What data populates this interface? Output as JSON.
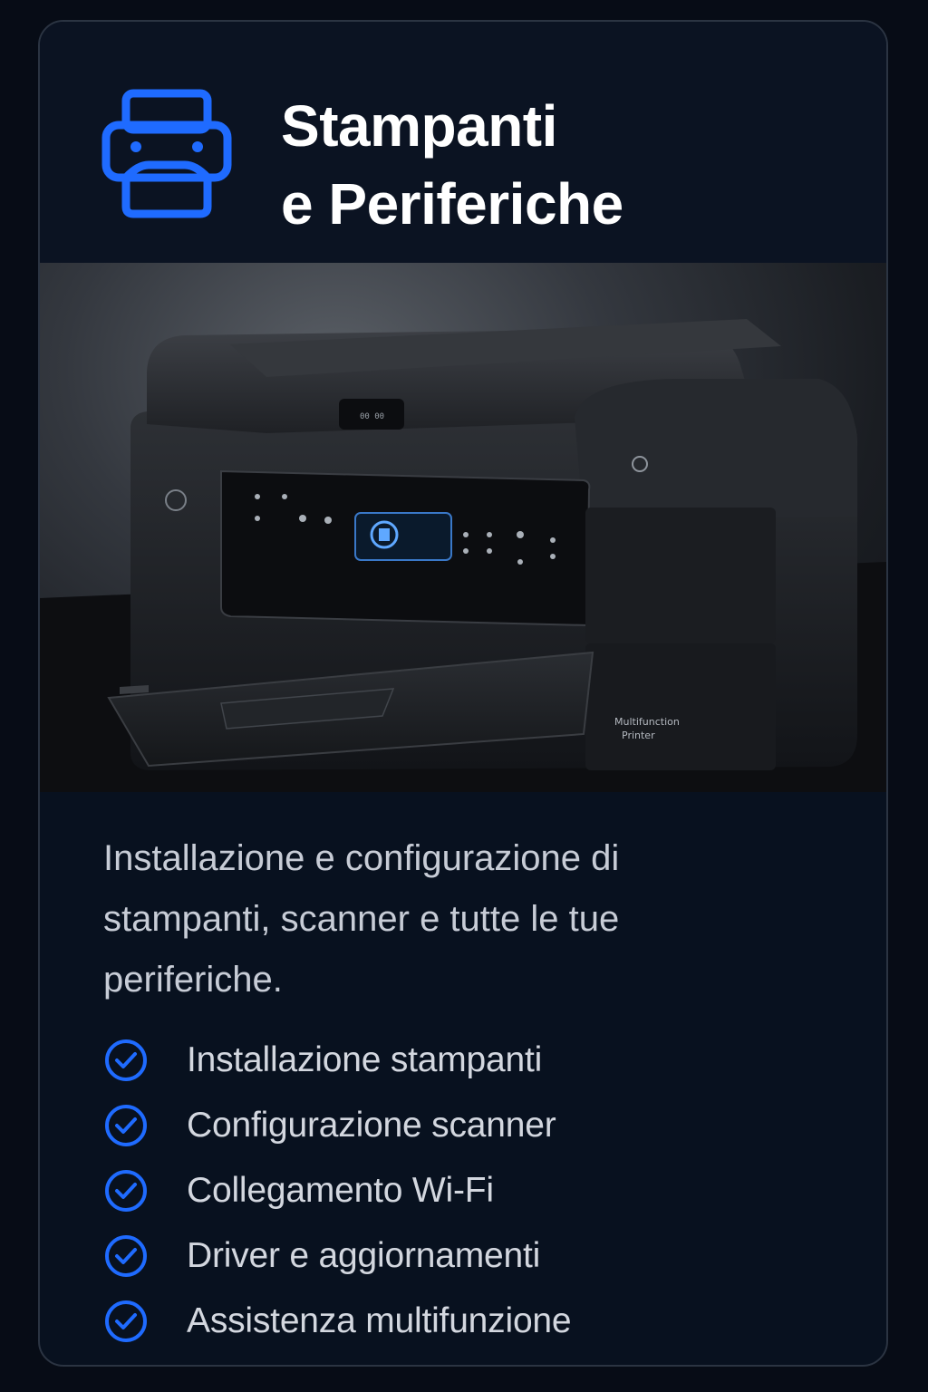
{
  "header": {
    "icon": "printer-icon",
    "title_line1": "Stampanti",
    "title_line2": "e Periferiche"
  },
  "hero": {
    "image": "multifunction-printer-photo",
    "printer_label_line1": "Multifunction",
    "printer_label_line2": "Printer"
  },
  "description": "Installazione e configurazione di stampanti, scanner e tutte le tue periferiche.",
  "features": [
    {
      "icon": "check-circle-icon",
      "label": "Installazione stampanti"
    },
    {
      "icon": "check-circle-icon",
      "label": "Configurazione scanner"
    },
    {
      "icon": "check-circle-icon",
      "label": "Collegamento Wi-Fi"
    },
    {
      "icon": "check-circle-icon",
      "label": "Driver e aggiornamenti"
    },
    {
      "icon": "check-circle-icon",
      "label": "Assistenza multifunzione"
    }
  ],
  "colors": {
    "accent": "#1f6bff",
    "background": "#08111f",
    "header_background": "#0b1322",
    "card_border": "#2b3442",
    "title": "#ffffff",
    "body_text": "#c7ccd6"
  }
}
